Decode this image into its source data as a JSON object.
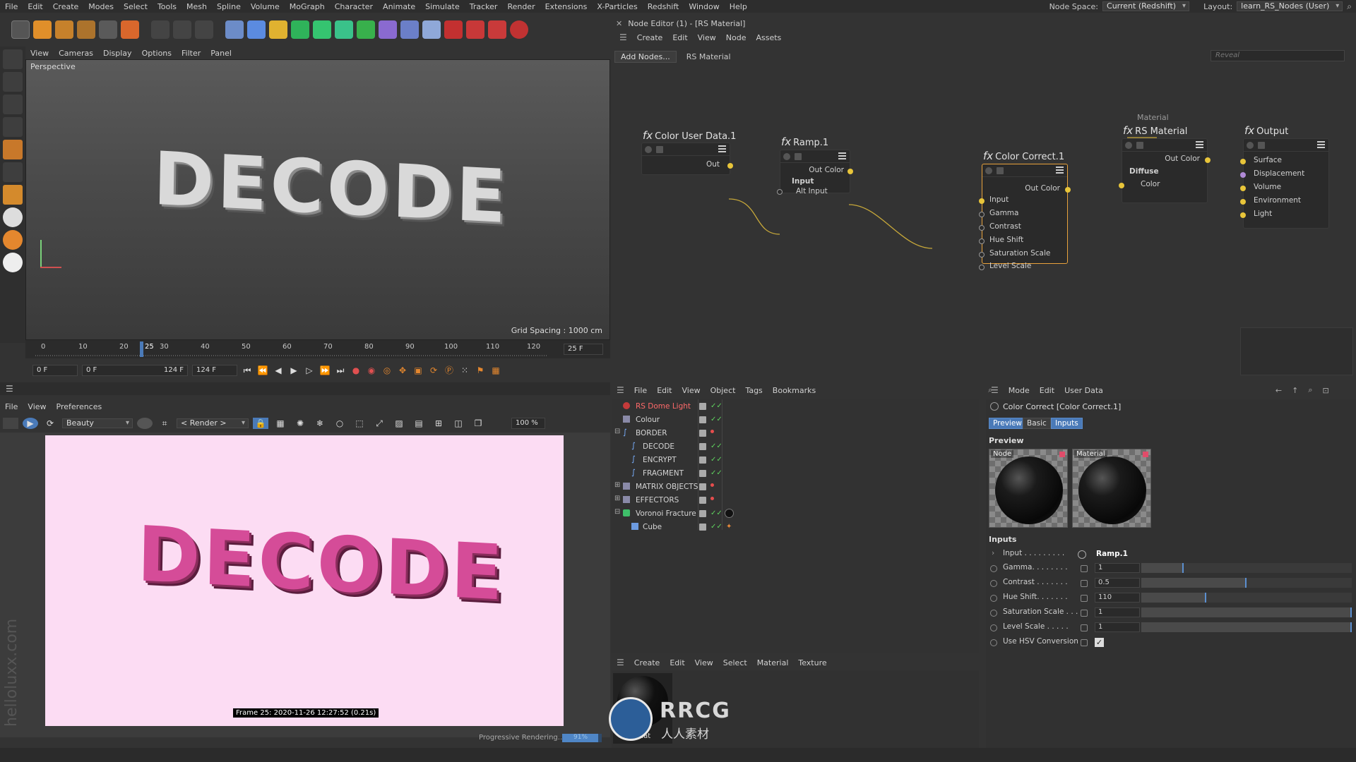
{
  "menubar": {
    "items": [
      "File",
      "Edit",
      "Create",
      "Modes",
      "Select",
      "Tools",
      "Mesh",
      "Spline",
      "Volume",
      "MoGraph",
      "Character",
      "Animate",
      "Simulate",
      "Tracker",
      "Render",
      "Extensions",
      "X-Particles",
      "Redshift",
      "Window",
      "Help"
    ],
    "node_space_label": "Node Space:",
    "node_space_value": "Current (Redshift)",
    "layout_label": "Layout:",
    "layout_value": "learn_RS_Nodes (User)"
  },
  "viewport": {
    "menu": [
      "View",
      "Cameras",
      "Display",
      "Options",
      "Filter",
      "Panel"
    ],
    "label": "Perspective",
    "grid_spacing": "Grid Spacing : 1000 cm",
    "scene_text": "DECODE"
  },
  "timeline": {
    "ticks": [
      "0",
      "10",
      "20",
      "25",
      "30",
      "40",
      "50",
      "60",
      "70",
      "80",
      "90",
      "100",
      "110",
      "120"
    ],
    "frame_box": "25 F",
    "current": "0 F",
    "start": "0 F",
    "end": "124 F",
    "end2": "124 F"
  },
  "picture_viewer": {
    "menu": [
      "File",
      "View",
      "Preferences"
    ],
    "channel": "Beauty",
    "render_sel": "< Render >",
    "zoom": "100 %",
    "stamp": "Frame  25:  2020-11-26  12:27:52  (0.21s)",
    "progress_label": "Progressive Rendering...",
    "progress_pct": "91%",
    "progress_value": 0.91,
    "watermark": "helloluxx.com"
  },
  "node_editor": {
    "title": "Node Editor (1) - [RS Material]",
    "menu": [
      "Create",
      "Edit",
      "View",
      "Node",
      "Assets"
    ],
    "add_nodes": "Add Nodes...",
    "breadcrumb": "RS Material",
    "reveal_placeholder": "Reveal",
    "group_label": "Material",
    "nodes": {
      "color_user_data": {
        "title": "Color User Data.1",
        "out": "Out"
      },
      "ramp": {
        "title": "Ramp.1",
        "out": "Out Color",
        "input": "Input",
        "alt_input": "Alt Input"
      },
      "color_correct": {
        "title": "Color Correct.1",
        "out": "Out Color",
        "ports": [
          "Input",
          "Gamma",
          "Contrast",
          "Hue Shift",
          "Saturation Scale",
          "Level Scale"
        ]
      },
      "rs_material": {
        "title": "RS Material",
        "out": "Out Color",
        "group": "Diffuse",
        "color": "Color"
      },
      "output": {
        "title": "Output",
        "ports": [
          "Surface",
          "Displacement",
          "Volume",
          "Environment",
          "Light"
        ]
      }
    }
  },
  "object_manager": {
    "menu": [
      "File",
      "Edit",
      "View",
      "Object",
      "Tags",
      "Bookmarks"
    ],
    "rows": [
      {
        "name": "RS Dome Light"
      },
      {
        "name": "Colour"
      },
      {
        "name": "BORDER"
      },
      {
        "name": "DECODE"
      },
      {
        "name": "ENCRYPT"
      },
      {
        "name": "FRAGMENT"
      },
      {
        "name": "MATRIX OBJECTS"
      },
      {
        "name": "EFFECTORS"
      },
      {
        "name": "Voronoi Fracture"
      },
      {
        "name": "Cube"
      }
    ]
  },
  "material_manager": {
    "menu": [
      "Create",
      "Edit",
      "View",
      "Select",
      "Material",
      "Texture"
    ],
    "mat_name": "RS Mat"
  },
  "attribute_manager": {
    "menu": [
      "Mode",
      "Edit",
      "User Data"
    ],
    "title": "Color Correct [Color Correct.1]",
    "tabs": [
      "Preview",
      "Basic",
      "Inputs"
    ],
    "preview_heading": "Preview",
    "preview_node": "Node",
    "preview_material": "Material",
    "inputs_heading": "Inputs",
    "input_label": "Input . . . . . . . . .",
    "input_value": "Ramp.1",
    "params": [
      {
        "label": "Gamma. . . . . . . .",
        "value": "1",
        "level": 0.2
      },
      {
        "label": "Contrast . . . . . . .",
        "value": "0.5",
        "level": 0.5
      },
      {
        "label": "Hue Shift. . . . . . .",
        "value": "110",
        "level": 0.31
      },
      {
        "label": "Saturation Scale . . .",
        "value": "1",
        "level": 1.0
      },
      {
        "label": "Level Scale . . . . .",
        "value": "1",
        "level": 1.0
      }
    ],
    "hsv_label": "Use HSV Conversion"
  },
  "watermark": {
    "brand": "RRCG",
    "sub": "人人素材"
  },
  "colors": {
    "accent": "#e8c53a",
    "selection": "#e8a23c",
    "tab_on": "#4a7ab8"
  }
}
